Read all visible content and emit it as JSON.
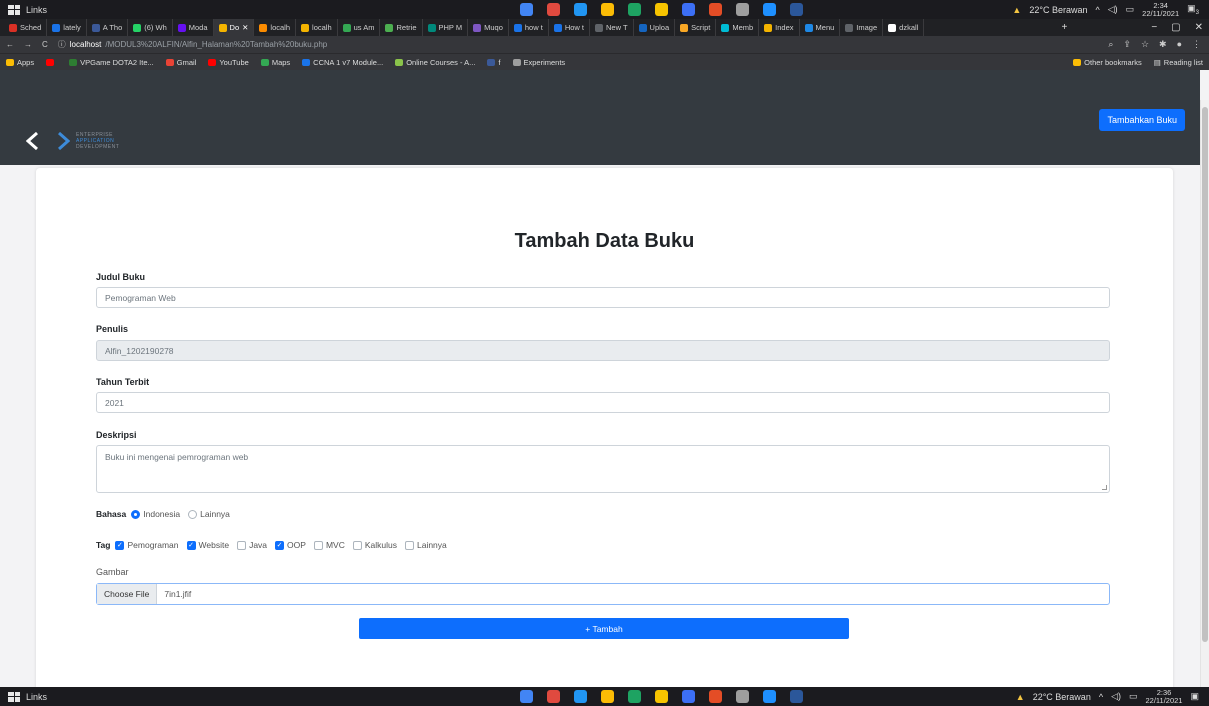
{
  "os_taskbar": {
    "links_label": "Links",
    "weather": "22°C Berawan",
    "time_top": "2:34",
    "date_top": "22/11/2021",
    "time_bottom": "2:36",
    "date_bottom": "22/11/2021",
    "notification_count": "3",
    "app_colors": [
      "#4285f4",
      "#e04a3f",
      "#2196f3",
      "#fbbc05",
      "#1ea362",
      "#f7c400",
      "#3c6ff5",
      "#e44d26",
      "#9e9e9e",
      "#1e90ff",
      "#2b579a"
    ]
  },
  "tabs": [
    {
      "label": "Sched",
      "color": "#d93025"
    },
    {
      "label": "lately",
      "color": "#1a73e8"
    },
    {
      "label": "A Tho",
      "color": "#3b5998"
    },
    {
      "label": "(6) Wh",
      "color": "#25d366"
    },
    {
      "label": "Moda",
      "color": "#6610f2"
    },
    {
      "label": "Do",
      "color": "#f4b400",
      "active": true
    },
    {
      "label": "localh",
      "color": "#fb8c00"
    },
    {
      "label": "localh",
      "color": "#f4b400"
    },
    {
      "label": "us Am",
      "color": "#34a853"
    },
    {
      "label": "Retrie",
      "color": "#4caf50"
    },
    {
      "label": "PHP M",
      "color": "#00897b"
    },
    {
      "label": "Muqo",
      "color": "#7e57c2"
    },
    {
      "label": "how t",
      "color": "#1a73e8"
    },
    {
      "label": "How t",
      "color": "#1a73e8"
    },
    {
      "label": "New T",
      "color": "#5f6368"
    },
    {
      "label": "Uploa",
      "color": "#1565c0"
    },
    {
      "label": "Script",
      "color": "#f9a825"
    },
    {
      "label": "Memb",
      "color": "#00bcd4"
    },
    {
      "label": "Index",
      "color": "#f4b400"
    },
    {
      "label": "Menu",
      "color": "#1e88e5"
    },
    {
      "label": "Image",
      "color": "#5f6368"
    },
    {
      "label": "dzkall",
      "color": "#ffffff"
    }
  ],
  "browser": {
    "url_host": "localhost",
    "url_path": "/MODUL3%20ALFIN/Alfin_Halaman%20Tambah%20buku.php",
    "new_tab": "+",
    "minimize": "−",
    "maximize": "▢",
    "close": "✕"
  },
  "bookmarks": [
    {
      "label": "Apps",
      "color": "#fbbc05"
    },
    {
      "label": "",
      "color": "#ff0000"
    },
    {
      "label": "VPGame DOTA2 Ite...",
      "color": "#2e7d32"
    },
    {
      "label": "Gmail",
      "color": "#ea4335"
    },
    {
      "label": "YouTube",
      "color": "#ff0000"
    },
    {
      "label": "Maps",
      "color": "#34a853"
    },
    {
      "label": "CCNA 1 v7 Module...",
      "color": "#1a73e8"
    },
    {
      "label": "Online Courses - A...",
      "color": "#8bc34a"
    },
    {
      "label": "f",
      "color": "#3b5998"
    },
    {
      "label": "Experiments",
      "color": "#9e9e9e"
    }
  ],
  "bookmarks_right": {
    "other": "Other bookmarks",
    "reading": "Reading list"
  },
  "navbar": {
    "logo_line1": "ENTERPRISE",
    "logo_line2": "APPLICATION",
    "logo_line3": "DEVELOPMENT",
    "add_button": "Tambahkan Buku"
  },
  "form": {
    "title": "Tambah Data Buku",
    "judul_label": "Judul Buku",
    "judul_value": "Pemograman Web",
    "penulis_label": "Penulis",
    "penulis_value": "Alfin_1202190278",
    "tahun_label": "Tahun Terbit",
    "tahun_value": "2021",
    "deskripsi_label": "Deskripsi",
    "deskripsi_value": "Buku ini mengenai pemrograman web",
    "bahasa_label": "Bahasa",
    "bahasa_options": [
      {
        "label": "Indonesia",
        "selected": true
      },
      {
        "label": "Lainnya",
        "selected": false
      }
    ],
    "tag_label": "Tag",
    "tag_options": [
      {
        "label": "Pemograman",
        "checked": true
      },
      {
        "label": "Website",
        "checked": true
      },
      {
        "label": "Java",
        "checked": false
      },
      {
        "label": "OOP",
        "checked": true
      },
      {
        "label": "MVC",
        "checked": false
      },
      {
        "label": "Kalkulus",
        "checked": false
      },
      {
        "label": "Lainnya",
        "checked": false
      }
    ],
    "gambar_label": "Gambar",
    "file_button": "Choose File",
    "file_name": "7in1.jfif",
    "submit_label": "+ Tambah"
  }
}
